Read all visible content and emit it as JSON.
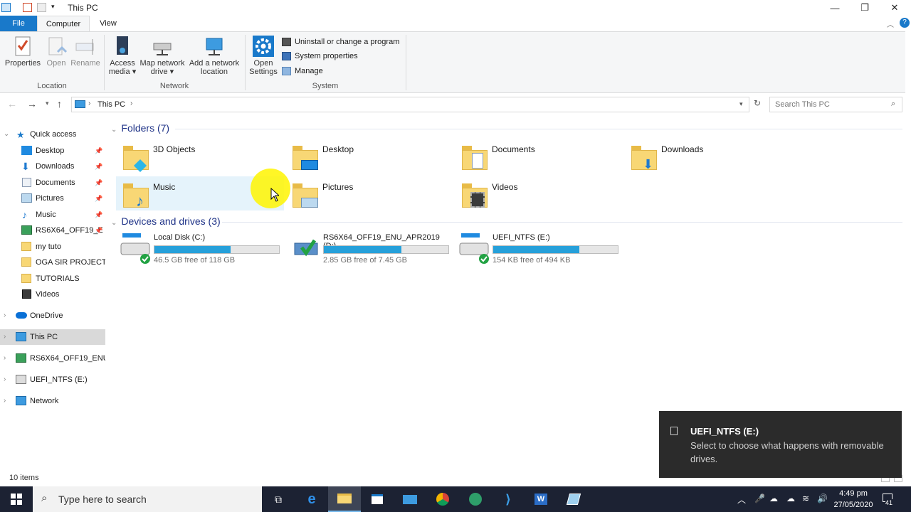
{
  "window": {
    "title": "This PC"
  },
  "tabs": {
    "file": "File",
    "computer": "Computer",
    "view": "View"
  },
  "ribbon": {
    "properties": "Properties",
    "open": "Open",
    "rename": "Rename",
    "access_media_1": "Access",
    "access_media_2": "media ▾",
    "map_drive_1": "Map network",
    "map_drive_2": "drive ▾",
    "add_location_1": "Add a network",
    "add_location_2": "location",
    "open_settings_1": "Open",
    "open_settings_2": "Settings",
    "uninstall": "Uninstall or change a program",
    "system_properties": "System properties",
    "manage": "Manage",
    "group_location": "Location",
    "group_network": "Network",
    "group_system": "System"
  },
  "address": {
    "path": "This PC",
    "search_placeholder": "Search This PC"
  },
  "navpane": {
    "quick_access": "Quick access",
    "items": [
      "Desktop",
      "Downloads",
      "Documents",
      "Pictures",
      "Music",
      "RS6X64_OFF19_E",
      "my tuto",
      "OGA SIR PROJECT",
      "TUTORIALS",
      "Videos"
    ],
    "onedrive": "OneDrive",
    "this_pc": "This PC",
    "drive_d": "RS6X64_OFF19_ENU_",
    "drive_e": "UEFI_NTFS (E:)",
    "network": "Network"
  },
  "content": {
    "folders_header": "Folders (7)",
    "folders": [
      "3D Objects",
      "Desktop",
      "Documents",
      "Downloads",
      "Music",
      "Pictures",
      "Videos"
    ],
    "drives_header": "Devices and drives (3)",
    "drives": [
      {
        "name": "Local Disk (C:)",
        "free": "46.5 GB free of 118 GB",
        "used_fraction": 0.61
      },
      {
        "name": "RS6X64_OFF19_ENU_APR2019 (D:)",
        "free": "2.85 GB free of 7.45 GB",
        "used_fraction": 0.62
      },
      {
        "name": "UEFI_NTFS (E:)",
        "free": "154 KB free of 494 KB",
        "used_fraction": 0.69
      }
    ]
  },
  "status": {
    "items": "10 items"
  },
  "toast": {
    "title": "UEFI_NTFS (E:)",
    "body": "Select to choose what happens with removable drives."
  },
  "taskbar": {
    "search_placeholder": "Type here to search",
    "time": "4:49 pm",
    "date": "27/05/2020",
    "notification_count": "41"
  },
  "colors": {
    "accent": "#1979ca",
    "drive_fill": "#26a0da",
    "taskbar": "#1c2233"
  }
}
